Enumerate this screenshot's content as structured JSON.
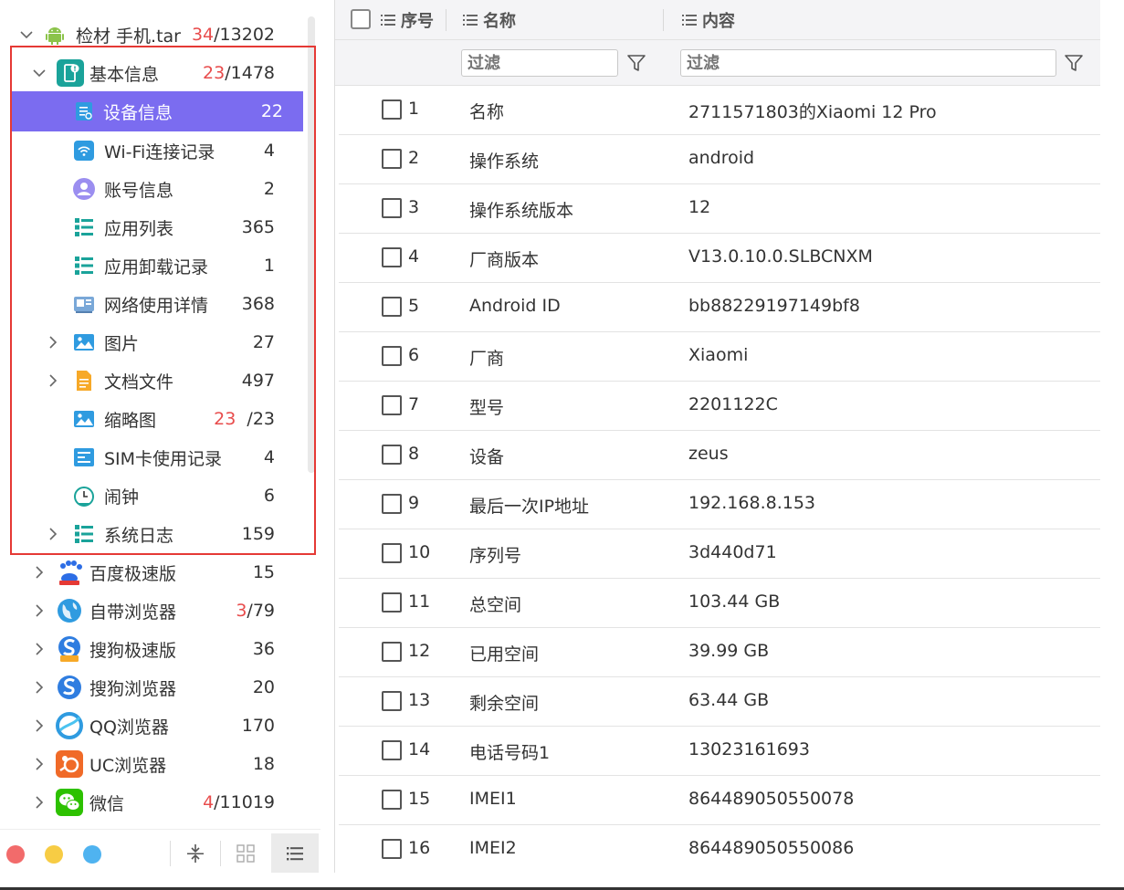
{
  "tree": {
    "root": {
      "label": "检材 手机.tar",
      "count_highlight": "34",
      "count_total": "/13202"
    },
    "basic": {
      "label": "基本信息",
      "count_highlight": "23",
      "count_total": "/1478"
    },
    "children": [
      {
        "label": "设备信息",
        "count": "22"
      },
      {
        "label": "Wi-Fi连接记录",
        "count": "4"
      },
      {
        "label": "账号信息",
        "count": "2"
      },
      {
        "label": "应用列表",
        "count": "365"
      },
      {
        "label": "应用卸载记录",
        "count": "1"
      },
      {
        "label": "网络使用详情",
        "count": "368"
      },
      {
        "label": "图片",
        "count": "27"
      },
      {
        "label": "文档文件",
        "count": "497"
      },
      {
        "label": "缩略图",
        "count_highlight": "23",
        "count_total": "/23"
      },
      {
        "label": "SIM卡使用记录",
        "count": "4"
      },
      {
        "label": "闹钟",
        "count": "6"
      },
      {
        "label": "系统日志",
        "count": "159"
      }
    ],
    "apps": [
      {
        "label": "百度极速版",
        "count": "15"
      },
      {
        "label": "自带浏览器",
        "count_highlight": "3",
        "count_total": "/79"
      },
      {
        "label": "搜狗极速版",
        "count": "36"
      },
      {
        "label": "搜狗浏览器",
        "count": "20"
      },
      {
        "label": "QQ浏览器",
        "count": "170"
      },
      {
        "label": "UC浏览器",
        "count": "18"
      },
      {
        "label": "微信",
        "count_highlight": "4",
        "count_total": "/11019"
      }
    ]
  },
  "colors": {
    "selected": "#7b6cf0",
    "highlight_border": "#e53935",
    "count_red": "#e84c4c"
  },
  "table": {
    "headers": {
      "seq": "序号",
      "name": "名称",
      "content": "内容"
    },
    "filter_placeholder": "过滤",
    "rows": [
      {
        "seq": "1",
        "name": "名称",
        "value": "2711571803的Xiaomi 12 Pro"
      },
      {
        "seq": "2",
        "name": "操作系统",
        "value": "android"
      },
      {
        "seq": "3",
        "name": "操作系统版本",
        "value": "12"
      },
      {
        "seq": "4",
        "name": "厂商版本",
        "value": "V13.0.10.0.SLBCNXM"
      },
      {
        "seq": "5",
        "name": "Android ID",
        "value": "bb88229197149bf8"
      },
      {
        "seq": "6",
        "name": "厂商",
        "value": "Xiaomi"
      },
      {
        "seq": "7",
        "name": "型号",
        "value": "2201122C"
      },
      {
        "seq": "8",
        "name": "设备",
        "value": "zeus"
      },
      {
        "seq": "9",
        "name": "最后一次IP地址",
        "value": "192.168.8.153"
      },
      {
        "seq": "10",
        "name": "序列号",
        "value": "3d440d71"
      },
      {
        "seq": "11",
        "name": "总空间",
        "value": "103.44 GB"
      },
      {
        "seq": "12",
        "name": "已用空间",
        "value": "39.99 GB"
      },
      {
        "seq": "13",
        "name": "剩余空间",
        "value": "63.44 GB"
      },
      {
        "seq": "14",
        "name": "电话号码1",
        "value": "13023161693"
      },
      {
        "seq": "15",
        "name": "IMEI1",
        "value": "864489050550078"
      },
      {
        "seq": "16",
        "name": "IMEI2",
        "value": "864489050550086"
      }
    ]
  }
}
